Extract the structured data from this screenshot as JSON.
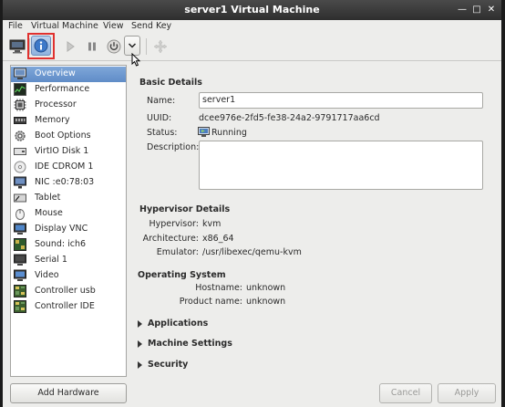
{
  "window": {
    "title": "server1 Virtual Machine"
  },
  "menu": [
    "File",
    "Virtual Machine",
    "View",
    "Send Key"
  ],
  "toolbar": {
    "icons": [
      "monitor-icon",
      "info-icon",
      "play-icon",
      "pause-icon",
      "power-icon",
      "chevron-down-icon",
      "move-icon"
    ],
    "active": "info-icon"
  },
  "sidebar": {
    "items": [
      {
        "label": "Overview",
        "icon": "monitor-icon",
        "selected": true
      },
      {
        "label": "Performance",
        "icon": "performance-icon"
      },
      {
        "label": "Processor",
        "icon": "cpu-icon"
      },
      {
        "label": "Memory",
        "icon": "memory-icon"
      },
      {
        "label": "Boot Options",
        "icon": "gear-icon"
      },
      {
        "label": "VirtIO Disk 1",
        "icon": "disk-icon"
      },
      {
        "label": "IDE CDROM 1",
        "icon": "cdrom-icon"
      },
      {
        "label": "NIC :e0:78:03",
        "icon": "network-icon"
      },
      {
        "label": "Tablet",
        "icon": "tablet-icon"
      },
      {
        "label": "Mouse",
        "icon": "mouse-icon"
      },
      {
        "label": "Display VNC",
        "icon": "display-icon"
      },
      {
        "label": "Sound: ich6",
        "icon": "sound-icon"
      },
      {
        "label": "Serial 1",
        "icon": "serial-icon"
      },
      {
        "label": "Video",
        "icon": "video-icon"
      },
      {
        "label": "Controller usb",
        "icon": "controller-icon"
      },
      {
        "label": "Controller IDE",
        "icon": "controller-icon"
      }
    ],
    "add_hardware": "Add Hardware"
  },
  "basic": {
    "heading": "Basic Details",
    "name_label": "Name:",
    "name_value": "server1",
    "uuid_label": "UUID:",
    "uuid_value": "dcee976e-2fd5-fe38-24a2-9791717aa6cd",
    "status_label": "Status:",
    "status_value": "Running",
    "description_label": "Description:",
    "description_value": ""
  },
  "hypervisor": {
    "heading": "Hypervisor Details",
    "hypervisor_label": "Hypervisor:",
    "hypervisor_value": "kvm",
    "arch_label": "Architecture:",
    "arch_value": "x86_64",
    "emulator_label": "Emulator:",
    "emulator_value": "/usr/libexec/qemu-kvm"
  },
  "os": {
    "heading": "Operating System",
    "hostname_label": "Hostname:",
    "hostname_value": "unknown",
    "product_label": "Product name:",
    "product_value": "unknown"
  },
  "expanders": [
    "Applications",
    "Machine Settings",
    "Security"
  ],
  "footer": {
    "cancel": "Cancel",
    "apply": "Apply"
  }
}
